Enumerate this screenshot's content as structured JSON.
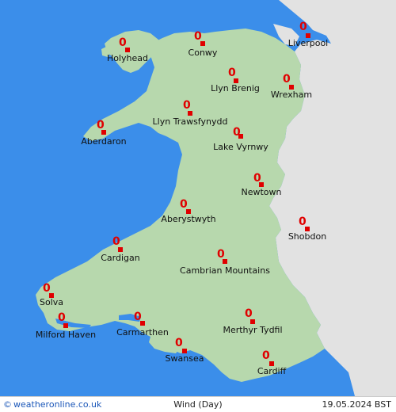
{
  "map": {
    "colors": {
      "sea": "#3b8eea",
      "land": "#b7d8ad",
      "neighbor_land": "#e2e2e2",
      "marker": "#e00000",
      "value_text": "#e00000",
      "label_text": "#111111"
    },
    "locations": [
      {
        "name": "Holyhead",
        "value": "0"
      },
      {
        "name": "Conwy",
        "value": "0"
      },
      {
        "name": "Liverpool",
        "value": "0"
      },
      {
        "name": "Llyn Brenig",
        "value": "0"
      },
      {
        "name": "Wrexham",
        "value": "0"
      },
      {
        "name": "Llyn Trawsfynydd",
        "value": "0"
      },
      {
        "name": "Aberdaron",
        "value": "0"
      },
      {
        "name": "Lake Vyrnwy",
        "value": "0"
      },
      {
        "name": "Newtown",
        "value": "0"
      },
      {
        "name": "Aberystwyth",
        "value": "0"
      },
      {
        "name": "Shobdon",
        "value": "0"
      },
      {
        "name": "Cardigan",
        "value": "0"
      },
      {
        "name": "Cambrian Mountains",
        "value": "0"
      },
      {
        "name": "Solva",
        "value": "0"
      },
      {
        "name": "Milford Haven",
        "value": "0"
      },
      {
        "name": "Carmarthen",
        "value": "0"
      },
      {
        "name": "Merthyr Tydfil",
        "value": "0"
      },
      {
        "name": "Swansea",
        "value": "0"
      },
      {
        "name": "Cardiff",
        "value": "0"
      }
    ]
  },
  "footer": {
    "brand_icon": "copyright-circle-icon",
    "brand_symbol": "©",
    "brand": "weatheronline.co.uk",
    "title": "Wind (Day)",
    "date": "19.05.2024 BST"
  }
}
